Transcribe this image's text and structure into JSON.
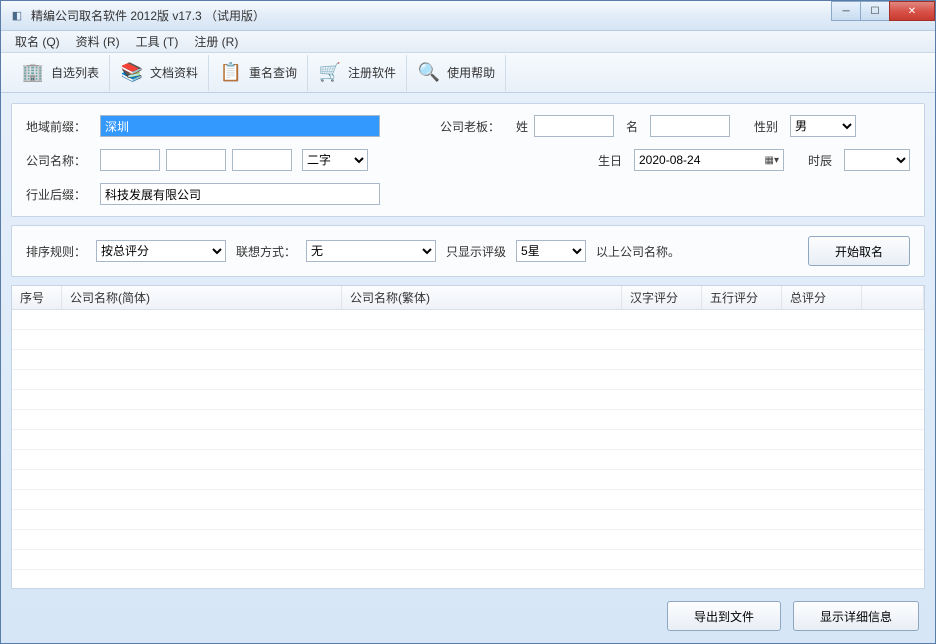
{
  "window": {
    "title": "精编公司取名软件 2012版 v17.3 （试用版）"
  },
  "menu": {
    "naming": "取名 (Q)",
    "materials": "资料 (R)",
    "tools": "工具 (T)",
    "register": "注册 (R)"
  },
  "toolbar": {
    "custom_list": "自选列表",
    "doc_materials": "文档资料",
    "dup_check": "重名查询",
    "register_sw": "注册软件",
    "help": "使用帮助"
  },
  "form": {
    "region_prefix_label": "地域前缀：",
    "region_prefix_value": "深圳",
    "company_name_label": "公司名称：",
    "word_count": "二字",
    "industry_suffix_label": "行业后缀：",
    "industry_suffix_value": "科技发展有限公司",
    "boss_label": "公司老板：",
    "surname_label": "姓",
    "givenname_label": "名",
    "gender_label": "性别",
    "gender_value": "男",
    "birthday_label": "生日",
    "birthday_value": "2020-08-24",
    "hour_label": "时辰"
  },
  "filter": {
    "sort_rule_label": "排序规则：",
    "sort_rule_value": "按总评分",
    "assoc_label": "联想方式：",
    "assoc_value": "无",
    "show_only_label": "只显示评级",
    "show_only_value": "5星",
    "suffix_text": "以上公司名称。",
    "start_button": "开始取名"
  },
  "table": {
    "col_no": "序号",
    "col_name_simp": "公司名称(简体)",
    "col_name_trad": "公司名称(繁体)",
    "col_hanzi_score": "汉字评分",
    "col_wuxing_score": "五行评分",
    "col_total_score": "总评分"
  },
  "bottom": {
    "export": "导出到文件",
    "details": "显示详细信息"
  }
}
